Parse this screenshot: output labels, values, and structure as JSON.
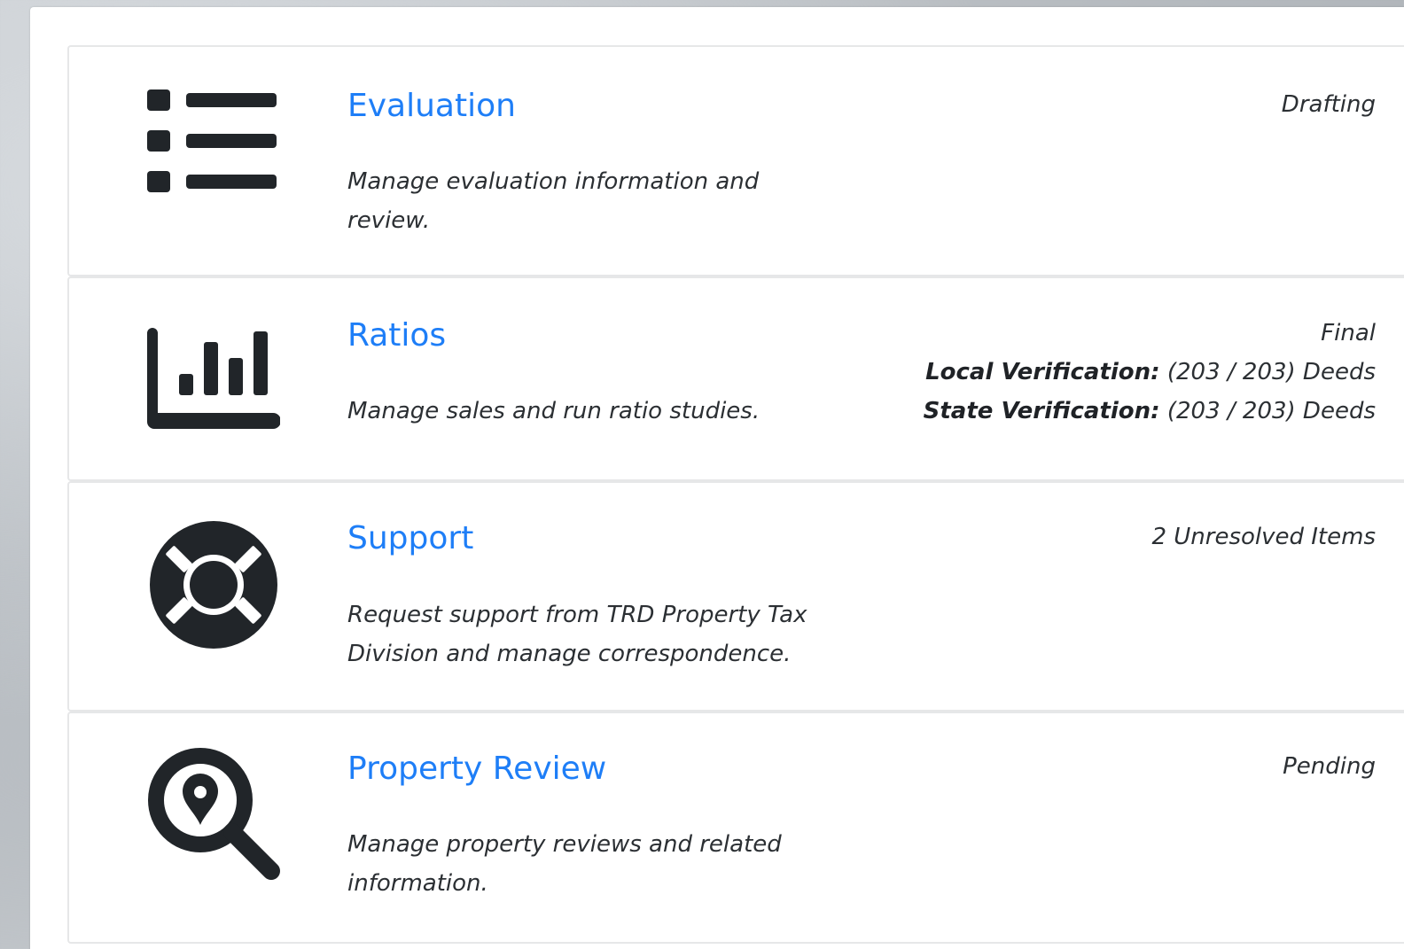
{
  "cards": [
    {
      "title": "Evaluation",
      "description": "Manage evaluation information and review.",
      "status": "Drafting",
      "icon": "list-icon"
    },
    {
      "title": "Ratios",
      "description": "Manage sales and run ratio studies.",
      "status": "Final",
      "local_label": "Local Verification:",
      "local_value": " (203 / 203) Deeds",
      "state_label": "State Verification:",
      "state_value": " (203 / 203) Deeds",
      "icon": "bar-chart-icon"
    },
    {
      "title": "Support",
      "description": "Request support from TRD Property Tax Division and manage correspondence.",
      "status": "2 Unresolved Items",
      "icon": "life-ring-icon"
    },
    {
      "title": "Property Review",
      "description": "Manage property reviews and related information.",
      "status": "Pending",
      "icon": "search-location-icon"
    }
  ],
  "colors": {
    "link": "#1e7ef7",
    "icon": "#212529",
    "text": "#2b2f33"
  }
}
